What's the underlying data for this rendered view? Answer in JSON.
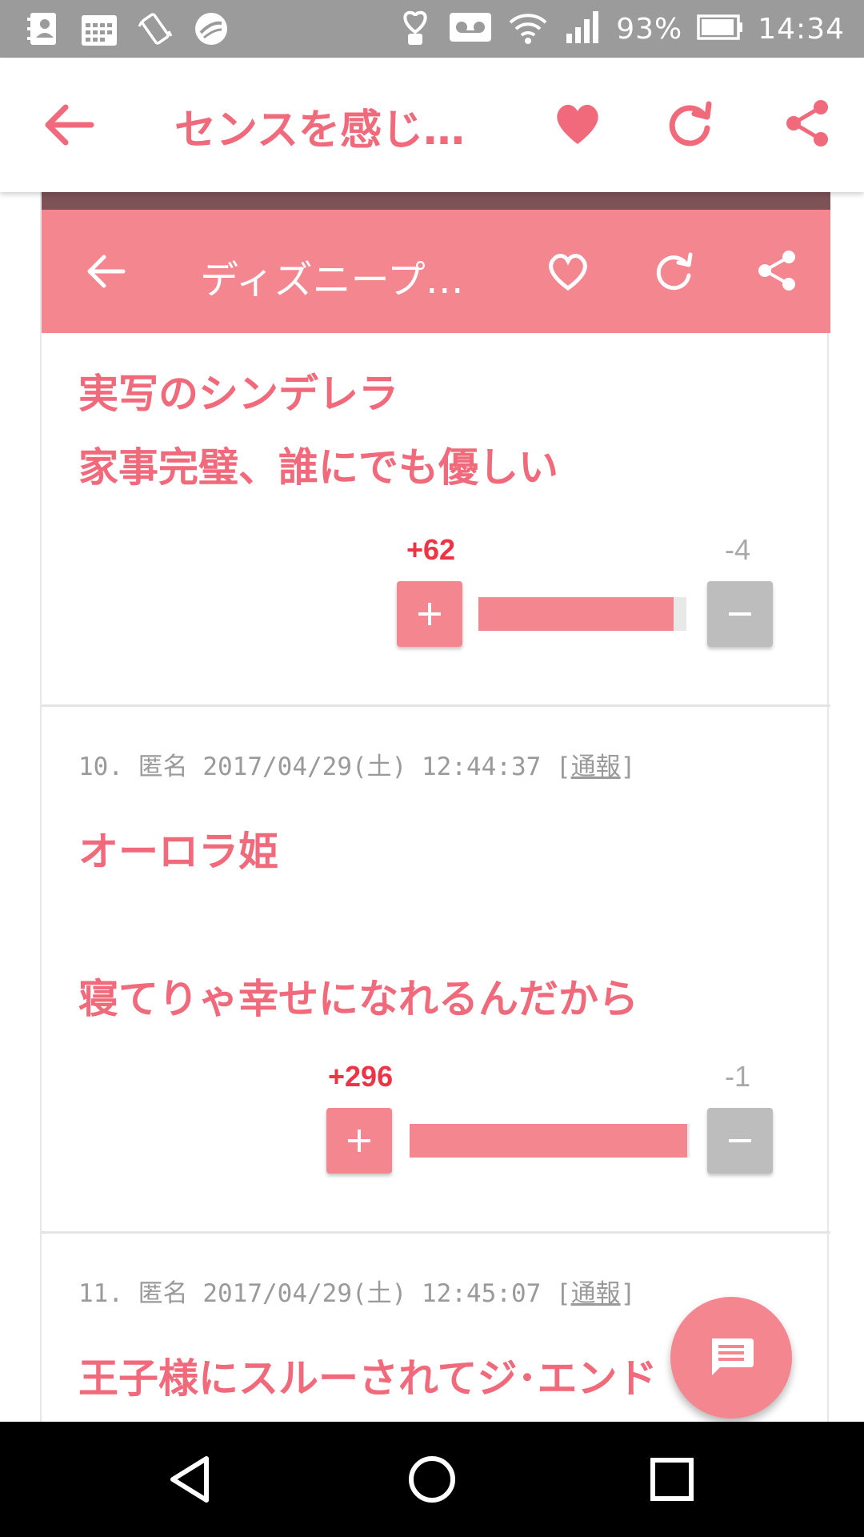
{
  "status_bar": {
    "battery": "93%",
    "time": "14:34",
    "left_icons": [
      "contacts-icon",
      "calendar-icon",
      "vibrate-icon",
      "app-circle-icon"
    ],
    "right_icons": [
      "heart-hand-icon",
      "voicemail-icon",
      "wifi-icon",
      "signal-icon",
      "battery-icon"
    ]
  },
  "app_bar": {
    "title": "センスを感じ…",
    "icons": [
      "back-arrow-icon",
      "heart-icon",
      "reload-icon",
      "share-icon"
    ]
  },
  "embedded": {
    "title": "ディズニープ…",
    "icons": [
      "back-arrow-icon",
      "heart-outline-icon",
      "reload-icon",
      "share-icon"
    ]
  },
  "comments": [
    {
      "lines": [
        "実写のシンデレラ",
        "家事完璧、誰にでも優しい"
      ],
      "plus": "+62",
      "minus": "-4",
      "plus_ratio": 0.94
    },
    {
      "number": "10.",
      "author": "匿名",
      "datetime": "2017/04/29(土) 12:44:37",
      "report": "通報",
      "lines": [
        "オーロラ姫",
        "",
        "寝てりゃ幸せになれるんだから"
      ],
      "plus": "+296",
      "minus": "-1",
      "plus_ratio": 0.99
    },
    {
      "number": "11.",
      "author": "匿名",
      "datetime": "2017/04/29(土) 12:45:07",
      "report": "通報",
      "lines": [
        "王子様にスルーされてジ･エンド"
      ]
    }
  ],
  "vote_labels": {
    "plus": "+",
    "minus": "−"
  },
  "colors": {
    "accent": "#f06a7b",
    "pink_bar": "#f48690",
    "grey": "#bdbdbd"
  }
}
